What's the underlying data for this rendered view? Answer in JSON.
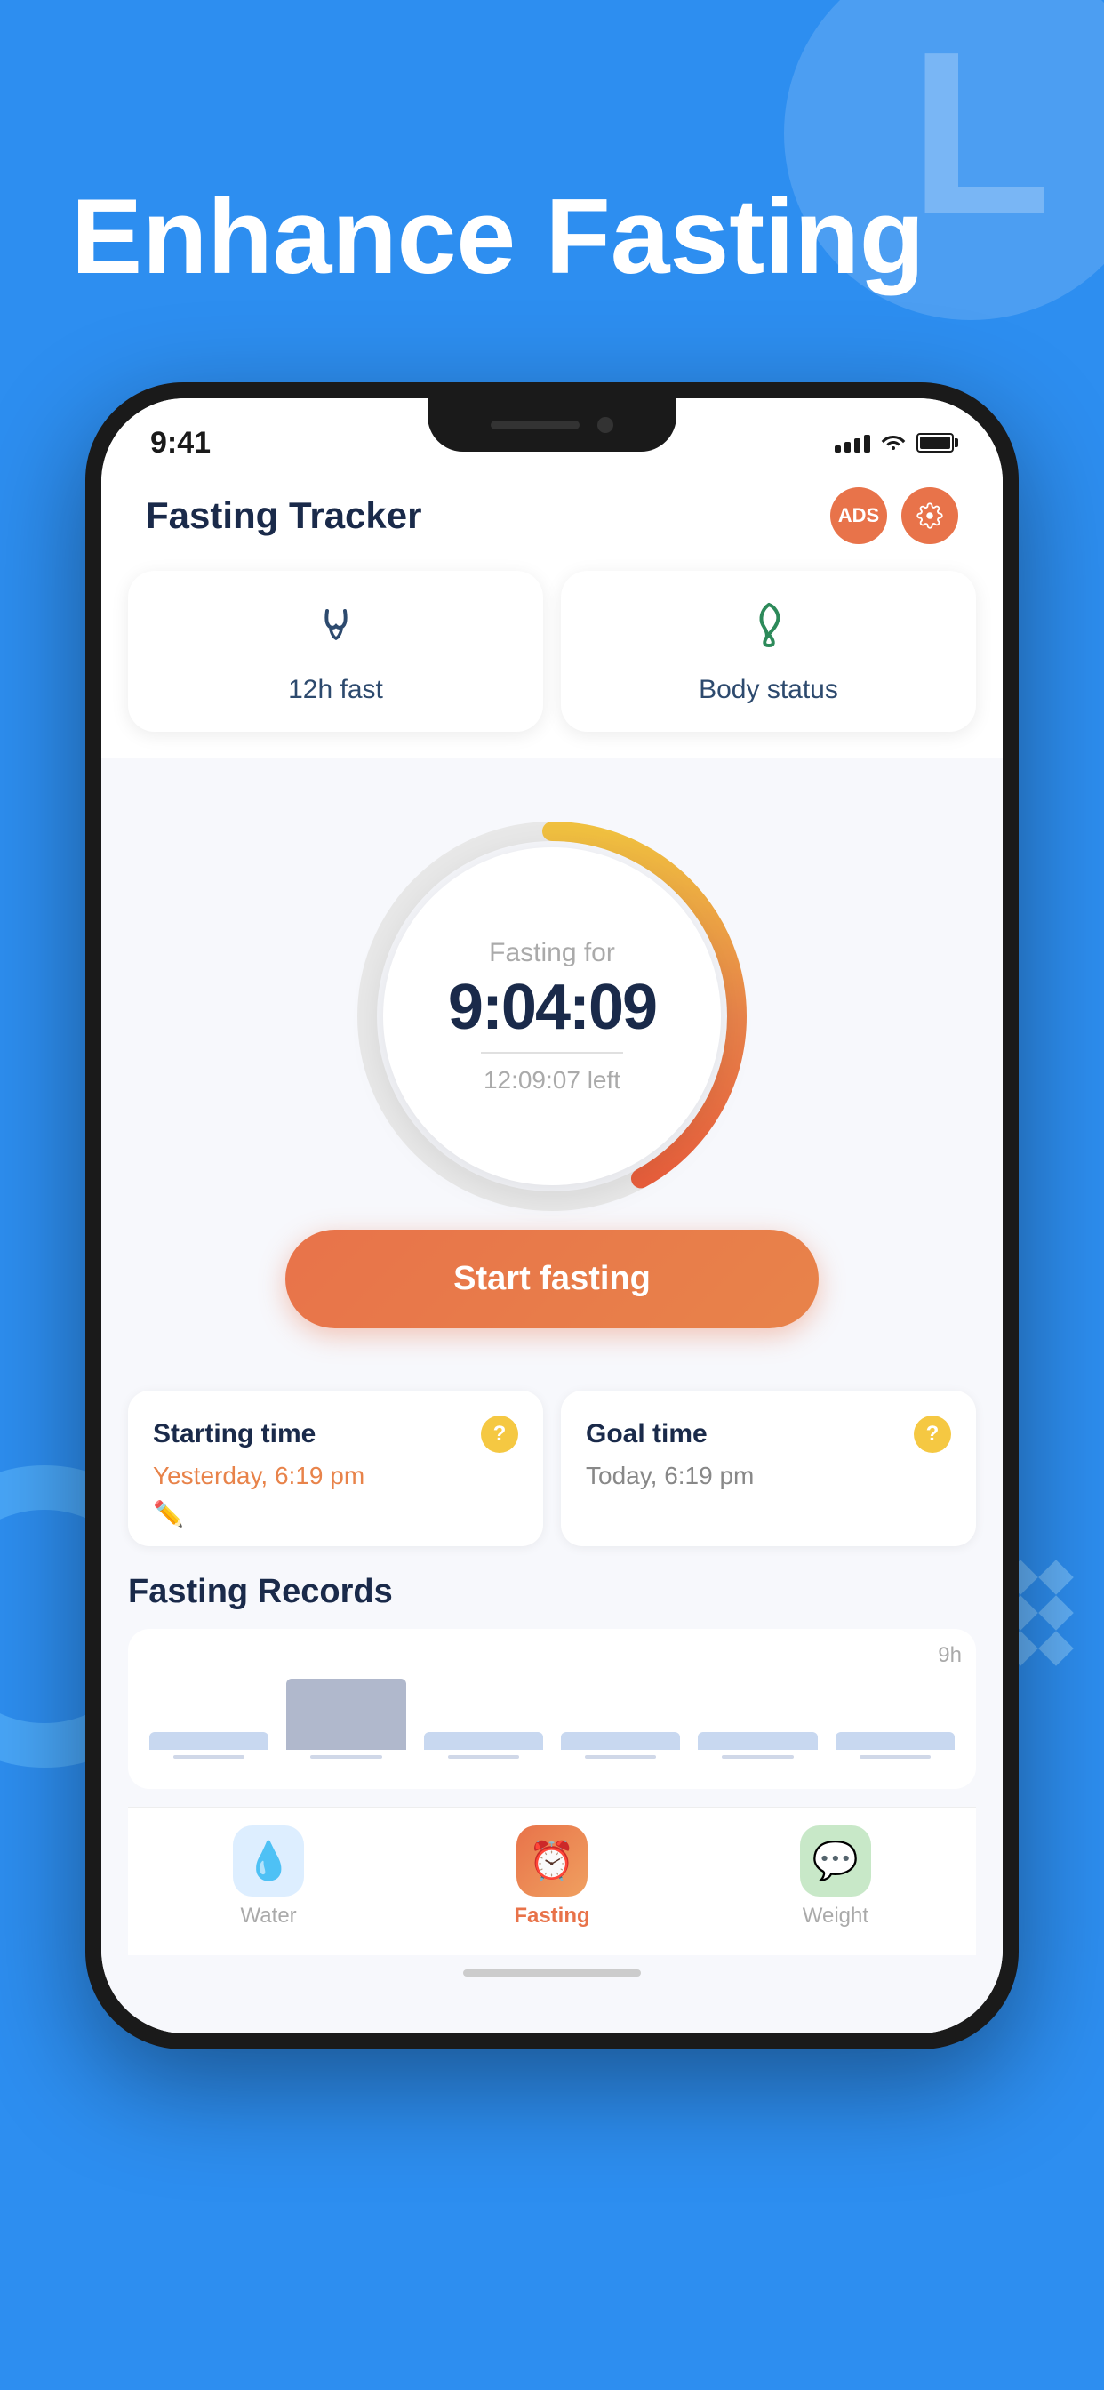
{
  "background": {
    "color": "#2d8ef0"
  },
  "page_title": "Enhance Fasting",
  "status_bar": {
    "time": "9:41",
    "signal": "4 bars",
    "wifi": true,
    "battery": "full"
  },
  "app_header": {
    "title": "Fasting Tracker",
    "ads_label": "ADS",
    "settings_label": "●"
  },
  "quick_cards": [
    {
      "icon": "hourglass",
      "label": "12h fast"
    },
    {
      "icon": "leaf",
      "label": "Body status"
    }
  ],
  "timer": {
    "label": "Fasting for",
    "time": "9:04:09",
    "left_label": "12:09:07 left",
    "progress_pct": 42
  },
  "start_button": {
    "label": "Start fasting"
  },
  "time_cards": [
    {
      "title": "Starting time",
      "value": "Yesterday, 6:19 pm",
      "has_edit": true
    },
    {
      "title": "Goal time",
      "value": "Today, 6:19 pm",
      "has_edit": false
    }
  ],
  "records_section": {
    "title": "Fasting Records",
    "chart_max_label": "9h",
    "bars": [
      {
        "height": 20,
        "active": false
      },
      {
        "height": 80,
        "active": true
      },
      {
        "height": 20,
        "active": false
      },
      {
        "height": 20,
        "active": false
      },
      {
        "height": 20,
        "active": false
      },
      {
        "height": 20,
        "active": false
      }
    ]
  },
  "bottom_nav": {
    "items": [
      {
        "label": "Water",
        "icon": "💧",
        "active": false,
        "bg": "water"
      },
      {
        "label": "Fasting",
        "icon": "⏰",
        "active": true,
        "bg": "fasting"
      },
      {
        "label": "Weight",
        "icon": "💬",
        "active": false,
        "bg": "weight"
      }
    ]
  }
}
